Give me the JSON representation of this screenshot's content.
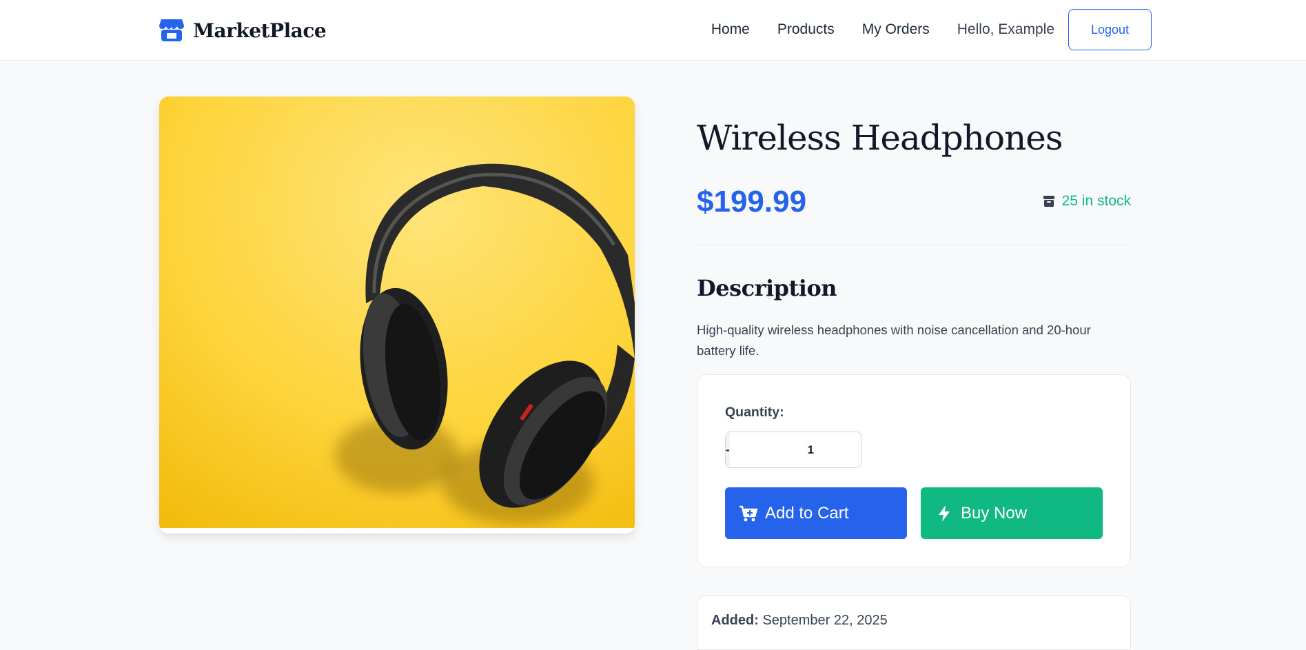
{
  "app": {
    "brand": "MarketPlace"
  },
  "nav": {
    "links": [
      "Home",
      "Products",
      "My Orders"
    ],
    "greeting": "Hello, Example",
    "logout": "Logout"
  },
  "product": {
    "title": "Wireless Headphones",
    "price": "$199.99",
    "stock": "25 in stock",
    "description_heading": "Description",
    "description": "High-quality wireless headphones with noise cancellation and 20-hour battery life.",
    "image_subject": "black over-ear headphones on a yellow background"
  },
  "purchase": {
    "quantity_label": "Quantity:",
    "quantity_value": "1",
    "decrement": "-",
    "increment": "+",
    "add_to_cart": "Add to Cart",
    "buy_now": "Buy Now"
  },
  "meta": {
    "added_label": "Added:",
    "added_value": "September 22, 2025"
  },
  "colors": {
    "primary": "#2563eb",
    "success": "#10b981",
    "page_bg": "#f8f9fb",
    "image_bg": "#fdd84a"
  },
  "icons": [
    "store-icon",
    "box-icon",
    "cart-plus-icon",
    "bolt-icon"
  ]
}
